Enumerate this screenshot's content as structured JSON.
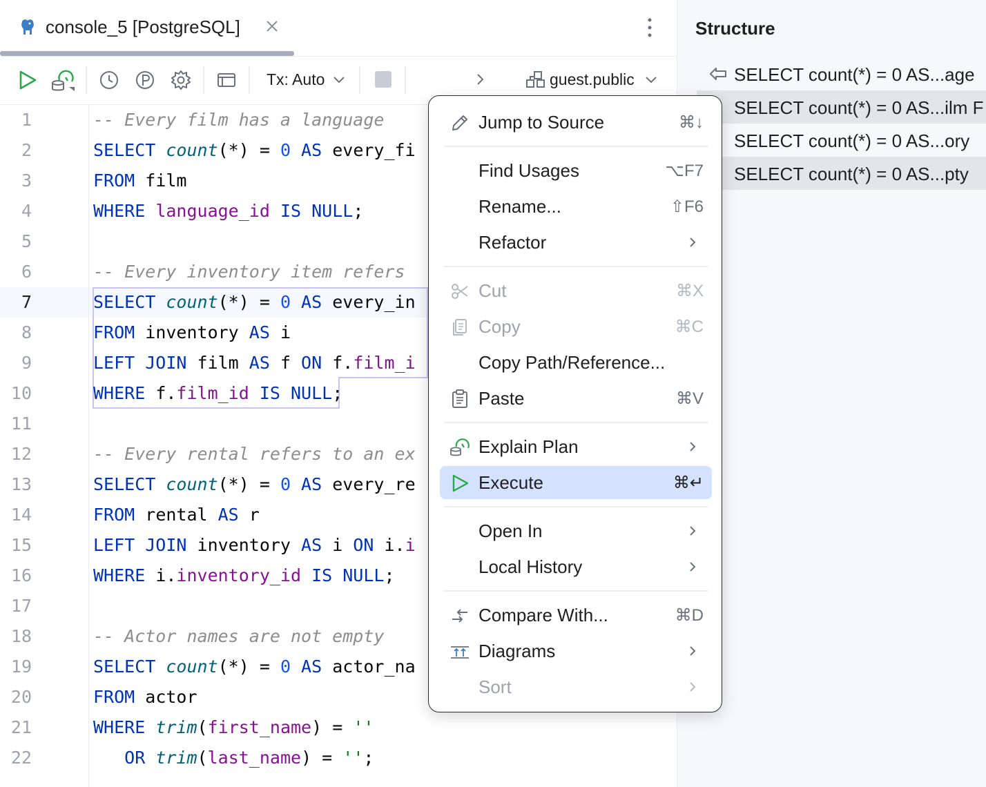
{
  "tab": {
    "label": "console_5 [PostgreSQL]",
    "icon": "postgresql-elephant-icon"
  },
  "toolbar": {
    "tx_label": "Tx: Auto",
    "schema_label": "guest.public"
  },
  "editor": {
    "current_line": 7,
    "lines": [
      {
        "n": "1"
      },
      {
        "n": "2"
      },
      {
        "n": "3"
      },
      {
        "n": "4"
      },
      {
        "n": "5"
      },
      {
        "n": "6"
      },
      {
        "n": "7"
      },
      {
        "n": "8"
      },
      {
        "n": "9"
      },
      {
        "n": "10"
      },
      {
        "n": "11"
      },
      {
        "n": "12"
      },
      {
        "n": "13"
      },
      {
        "n": "14"
      },
      {
        "n": "15"
      },
      {
        "n": "16"
      },
      {
        "n": "17"
      },
      {
        "n": "18"
      },
      {
        "n": "19"
      },
      {
        "n": "20"
      },
      {
        "n": "21"
      },
      {
        "n": "22"
      }
    ],
    "code": [
      [
        [
          "cm",
          "-- Every film has a language"
        ]
      ],
      [
        [
          "kw",
          "SELECT "
        ],
        [
          "fn",
          "count"
        ],
        [
          "plain",
          "(*) = "
        ],
        [
          "num",
          "0"
        ],
        [
          "kw",
          " AS "
        ],
        [
          "plain",
          "every_fi"
        ]
      ],
      [
        [
          "kw",
          "FROM "
        ],
        [
          "plain",
          "film"
        ]
      ],
      [
        [
          "kw",
          "WHERE "
        ],
        [
          "col",
          "language_id"
        ],
        [
          "kw",
          " IS NULL"
        ],
        [
          "plain",
          ";"
        ]
      ],
      [],
      [
        [
          "cm",
          "-- Every inventory item refers"
        ]
      ],
      [
        [
          "kw",
          "SELECT "
        ],
        [
          "fn",
          "count"
        ],
        [
          "plain",
          "(*) = "
        ],
        [
          "num",
          "0"
        ],
        [
          "kw",
          " AS "
        ],
        [
          "plain",
          "every_in"
        ]
      ],
      [
        [
          "kw",
          "FROM "
        ],
        [
          "plain",
          "inventory "
        ],
        [
          "kw",
          "AS "
        ],
        [
          "plain",
          "i"
        ]
      ],
      [
        [
          "kw",
          "LEFT JOIN "
        ],
        [
          "plain",
          "film "
        ],
        [
          "kw",
          "AS "
        ],
        [
          "plain",
          "f "
        ],
        [
          "kw",
          "ON "
        ],
        [
          "plain",
          "f."
        ],
        [
          "col",
          "film_i"
        ]
      ],
      [
        [
          "kw",
          "WHERE "
        ],
        [
          "plain",
          "f."
        ],
        [
          "col",
          "film_id"
        ],
        [
          "kw",
          " IS NULL"
        ],
        [
          "plain",
          ";"
        ]
      ],
      [],
      [
        [
          "cm",
          "-- Every rental refers to an ex"
        ]
      ],
      [
        [
          "kw",
          "SELECT "
        ],
        [
          "fn",
          "count"
        ],
        [
          "plain",
          "(*) = "
        ],
        [
          "num",
          "0"
        ],
        [
          "kw",
          " AS "
        ],
        [
          "plain",
          "every_re"
        ]
      ],
      [
        [
          "kw",
          "FROM "
        ],
        [
          "plain",
          "rental "
        ],
        [
          "kw",
          "AS "
        ],
        [
          "plain",
          "r"
        ]
      ],
      [
        [
          "kw",
          "LEFT JOIN "
        ],
        [
          "plain",
          "inventory "
        ],
        [
          "kw",
          "AS "
        ],
        [
          "plain",
          "i "
        ],
        [
          "kw",
          "ON "
        ],
        [
          "plain",
          "i."
        ],
        [
          "col",
          "i"
        ]
      ],
      [
        [
          "kw",
          "WHERE "
        ],
        [
          "plain",
          "i."
        ],
        [
          "col",
          "inventory_id"
        ],
        [
          "kw",
          " IS NULL"
        ],
        [
          "plain",
          ";"
        ]
      ],
      [],
      [
        [
          "cm",
          "-- Actor names are not empty"
        ]
      ],
      [
        [
          "kw",
          "SELECT "
        ],
        [
          "fn",
          "count"
        ],
        [
          "plain",
          "(*) = "
        ],
        [
          "num",
          "0"
        ],
        [
          "kw",
          " AS "
        ],
        [
          "plain",
          "actor_na"
        ]
      ],
      [
        [
          "kw",
          "FROM "
        ],
        [
          "plain",
          "actor"
        ]
      ],
      [
        [
          "kw",
          "WHERE "
        ],
        [
          "fn",
          "trim"
        ],
        [
          "plain",
          "("
        ],
        [
          "col",
          "first_name"
        ],
        [
          "plain",
          ") = "
        ],
        [
          "str",
          "''"
        ]
      ],
      [
        [
          "plain",
          "   "
        ],
        [
          "kw",
          "OR "
        ],
        [
          "fn",
          "trim"
        ],
        [
          "plain",
          "("
        ],
        [
          "col",
          "last_name"
        ],
        [
          "plain",
          ") = "
        ],
        [
          "str",
          "''"
        ],
        [
          "plain",
          ";"
        ]
      ]
    ]
  },
  "structure": {
    "title": "Structure",
    "items": [
      {
        "label": "SELECT count(*) = 0 AS...age"
      },
      {
        "label": "SELECT count(*) = 0 AS...ilm F"
      },
      {
        "label": "SELECT count(*) = 0 AS...ory"
      },
      {
        "label": "SELECT count(*) = 0 AS...pty"
      }
    ]
  },
  "context_menu": {
    "items": [
      {
        "label": "Jump to Source",
        "shortcut": "⌘↓",
        "icon": "pencil-icon"
      },
      {
        "label": "Find Usages",
        "shortcut": "⌥F7"
      },
      {
        "label": "Rename...",
        "shortcut": "⇧F6"
      },
      {
        "label": "Refactor",
        "submenu": true
      },
      {
        "label": "Cut",
        "shortcut": "⌘X",
        "icon": "scissors-icon",
        "disabled": true
      },
      {
        "label": "Copy",
        "shortcut": "⌘C",
        "icon": "copy-icon",
        "disabled": true
      },
      {
        "label": "Copy Path/Reference..."
      },
      {
        "label": "Paste",
        "shortcut": "⌘V",
        "icon": "clipboard-icon"
      },
      {
        "label": "Explain Plan",
        "submenu": true,
        "icon": "explain-plan-icon"
      },
      {
        "label": "Execute",
        "shortcut": "⌘↵",
        "icon": "play-icon",
        "active": true
      },
      {
        "label": "Open In",
        "submenu": true
      },
      {
        "label": "Local History",
        "submenu": true
      },
      {
        "label": "Compare With...",
        "shortcut": "⌘D",
        "icon": "compare-arrows-icon"
      },
      {
        "label": "Diagrams",
        "submenu": true,
        "icon": "diagrams-icon"
      },
      {
        "label": "Sort",
        "submenu": true,
        "disabled": true
      }
    ]
  },
  "colors": {
    "keyword": "#0033b3",
    "function": "#00627a",
    "number": "#1750eb",
    "column": "#871094",
    "comment": "#8c8c8c",
    "string": "#067d17",
    "run_green": "#2ba84a",
    "menu_highlight": "#d4e2ff"
  }
}
